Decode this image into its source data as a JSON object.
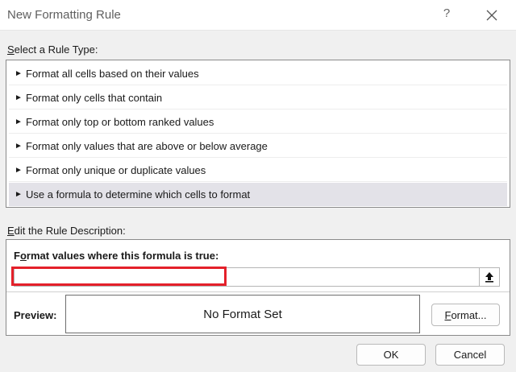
{
  "window": {
    "title": "New Formatting Rule",
    "help_label": "?"
  },
  "rule_type": {
    "label_accel": "S",
    "label_rest": "elect a Rule Type:",
    "items": [
      {
        "label": "Format all cells based on their values",
        "selected": false
      },
      {
        "label": "Format only cells that contain",
        "selected": false
      },
      {
        "label": "Format only top or bottom ranked values",
        "selected": false
      },
      {
        "label": "Format only values that are above or below average",
        "selected": false
      },
      {
        "label": "Format only unique or duplicate values",
        "selected": false
      },
      {
        "label": "Use a formula to determine which cells to format",
        "selected": true
      }
    ],
    "arrow_glyph": "►"
  },
  "description": {
    "label_accel": "E",
    "label_rest": "dit the Rule Description:",
    "formula_label_pre": "F",
    "formula_label_accel": "o",
    "formula_label_rest": "rmat values where this formula is true:",
    "formula_value": "",
    "preview_label": "Preview:",
    "preview_text": "No Format Set",
    "format_button_accel": "F",
    "format_button_rest": "ormat..."
  },
  "buttons": {
    "ok": "OK",
    "cancel": "Cancel"
  },
  "colors": {
    "highlight": "#e4202a",
    "selected_row": "#e3e2e8"
  }
}
